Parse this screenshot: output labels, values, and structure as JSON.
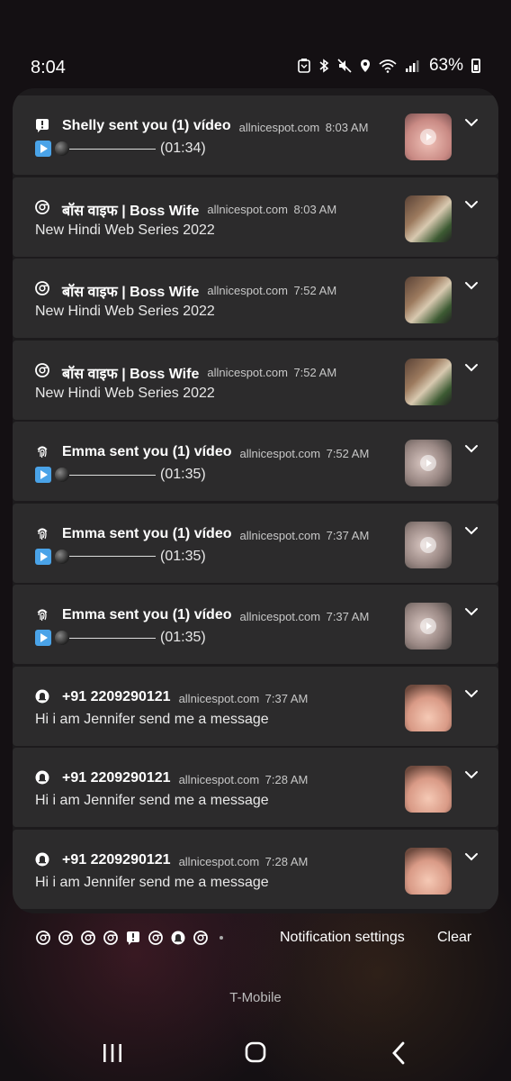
{
  "status_bar": {
    "time": "8:04",
    "battery_percent": "63%",
    "icons": [
      "nfc-icon",
      "bluetooth-icon",
      "mute-icon",
      "location-icon",
      "wifi-icon",
      "signal-icon",
      "battery-icon"
    ]
  },
  "notifications": [
    {
      "app_icon": "alert-icon",
      "title": "Shelly sent you (1) vídeo",
      "source": "allnicespot.com",
      "time": "8:03 AM",
      "body_type": "player",
      "duration": "(01:34)",
      "thumb": "skin"
    },
    {
      "app_icon": "chrome-icon",
      "title": "बॉस वाइफ | Boss Wife",
      "source": "allnicespot.com",
      "time": "8:03 AM",
      "body_type": "text",
      "body": "New Hindi Web Series 2022",
      "thumb": "video"
    },
    {
      "app_icon": "chrome-icon",
      "title": "बॉस वाइफ | Boss Wife",
      "source": "allnicespot.com",
      "time": "7:52 AM",
      "body_type": "text",
      "body": "New Hindi Web Series 2022",
      "thumb": "video"
    },
    {
      "app_icon": "chrome-icon",
      "title": "बॉस वाइफ | Boss Wife",
      "source": "allnicespot.com",
      "time": "7:52 AM",
      "body_type": "text",
      "body": "New Hindi Web Series 2022",
      "thumb": "video"
    },
    {
      "app_icon": "fingerprint-icon",
      "title": "Emma sent you (1) vídeo",
      "source": "allnicespot.com",
      "time": "7:52 AM",
      "body_type": "player",
      "duration": "(01:35)",
      "thumb": "grey"
    },
    {
      "app_icon": "fingerprint-icon",
      "title": "Emma sent you (1) vídeo",
      "source": "allnicespot.com",
      "time": "7:37 AM",
      "body_type": "player",
      "duration": "(01:35)",
      "thumb": "grey"
    },
    {
      "app_icon": "fingerprint-icon",
      "title": "Emma sent you (1) vídeo",
      "source": "allnicespot.com",
      "time": "7:37 AM",
      "body_type": "player",
      "duration": "(01:35)",
      "thumb": "grey"
    },
    {
      "app_icon": "bell-icon",
      "title": "+91 2209290121",
      "source": "allnicespot.com",
      "time": "7:37 AM",
      "body_type": "text",
      "body": "Hi i am Jennifer send me a message",
      "thumb": "face"
    },
    {
      "app_icon": "bell-icon",
      "title": "+91 2209290121",
      "source": "allnicespot.com",
      "time": "7:28 AM",
      "body_type": "text",
      "body": "Hi i am Jennifer send me a message",
      "thumb": "face"
    },
    {
      "app_icon": "bell-icon",
      "title": "+91 2209290121",
      "source": "allnicespot.com",
      "time": "7:28 AM",
      "body_type": "text",
      "body": "Hi i am Jennifer send me a message",
      "thumb": "face"
    }
  ],
  "bottom": {
    "mini_icons": [
      "chrome-icon",
      "chrome-icon",
      "chrome-icon",
      "chrome-icon",
      "alert-icon",
      "chrome-icon",
      "bell-icon",
      "chrome-icon"
    ],
    "settings_label": "Notification settings",
    "clear_label": "Clear"
  },
  "carrier": "T-Mobile",
  "colors": {
    "panel": "#1d1b1d",
    "card": "#2c2b2c",
    "accent_play": "#4aa3e8"
  }
}
